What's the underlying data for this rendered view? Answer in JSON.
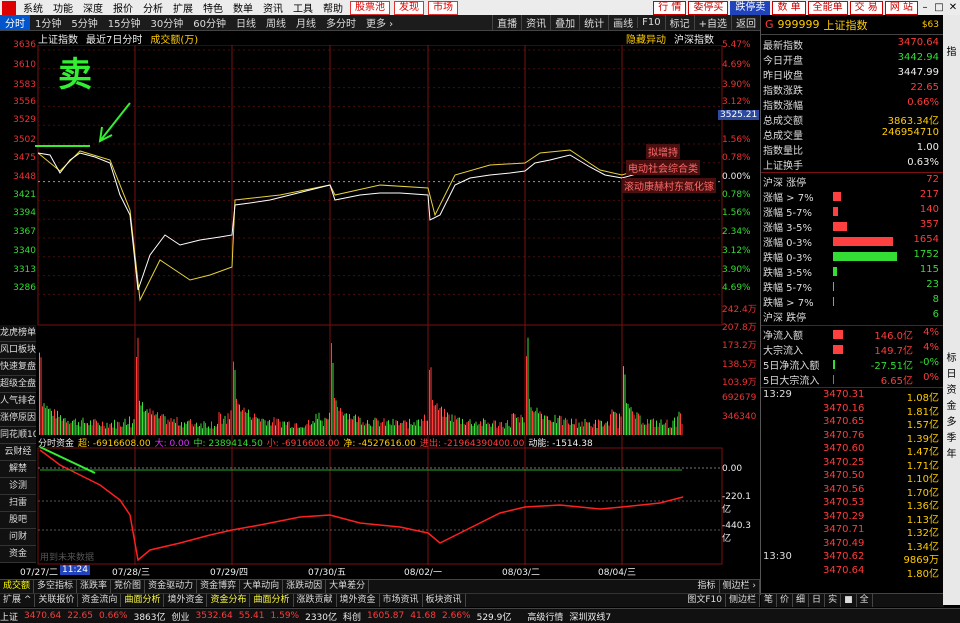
{
  "menubar": {
    "items": [
      "系统",
      "功能",
      "深度",
      "报价",
      "分析",
      "扩展",
      "特色",
      "数单",
      "资讯",
      "工具",
      "帮助"
    ],
    "hot": [
      "股票池",
      "发现",
      "市场"
    ],
    "right_btns": [
      "行 情",
      "委停买",
      "跌停卖",
      "数 单",
      "全能单",
      "交 易",
      "网 站"
    ]
  },
  "toolbar": {
    "periods": [
      "分时",
      "1分钟",
      "5分钟",
      "15分钟",
      "30分钟",
      "60分钟",
      "日线",
      "周线",
      "月线",
      "多分时",
      "更多 ›"
    ],
    "right": [
      "直播",
      "资讯",
      "叠加",
      "统计",
      "画线",
      "F10",
      "标记",
      "+自选",
      "返回"
    ]
  },
  "chart": {
    "index_name": "上证指数",
    "period_label": "最近7日分时",
    "volume_label": "成交额(万)",
    "hidden_move": "隐藏异动",
    "hs_depth": "沪深指数",
    "annotation_sell": "卖",
    "tag1": "拟增持",
    "tag2": "电动社会综合类",
    "tag3": "滚动康赫村东氮化镓",
    "price_marker": "3525.21",
    "y_left": [
      "3636",
      "3610",
      "3583",
      "3556",
      "3529",
      "3502",
      "3475",
      "3448",
      "3421",
      "3394",
      "3367",
      "3340",
      "3313",
      "3286"
    ],
    "y_right": [
      "5.47%",
      "4.69%",
      "3.90%",
      "3.12%",
      "2.34%",
      "1.56%",
      "0.78%",
      "0.00%",
      "0.78%",
      "1.56%",
      "2.34%",
      "3.12%",
      "3.90%",
      "4.69%"
    ],
    "vol_right": [
      "242.4万",
      "207.8万",
      "173.2万",
      "138.5万",
      "103.9万",
      "692679",
      "346340"
    ],
    "x_labels": [
      "07/27/二",
      "11:24",
      "07/28/三",
      "07/29/四",
      "07/30/五",
      "08/02/一",
      "08/03/二",
      "08/04/三"
    ]
  },
  "side_buttons": [
    "龙虎榜单",
    "风口板块",
    "快速复盘",
    "超级全盘",
    "人气排名",
    "涨停原因",
    "同花顺10"
  ],
  "flow_side": [
    "云财经",
    "解禁",
    "诊测",
    "扫雷",
    "股吧",
    "问财",
    "资金"
  ],
  "flow": {
    "title": "分时资金",
    "super": "超: -6916608.00",
    "big": "大: 0.00",
    "mid": "中: 2389414.50",
    "small": "小: -6916608.00",
    "net": "净: -4527616.00",
    "out": "进出: -21964390400.00",
    "power": "动能: -1514.38",
    "y_labels": [
      "0.00",
      "-220.1亿",
      "-440.3亿"
    ],
    "watermark": "用到未来数据"
  },
  "right_panel": {
    "code": "999999",
    "name": "上证指数",
    "badge": "$63",
    "rows": [
      {
        "k": "最新指数",
        "v": "3470.64",
        "c": "red"
      },
      {
        "k": "今日开盘",
        "v": "3442.94",
        "c": "green"
      },
      {
        "k": "昨日收盘",
        "v": "3447.99",
        "c": "wht"
      },
      {
        "k": "指数涨跌",
        "v": "22.65",
        "c": "red"
      },
      {
        "k": "指数涨幅",
        "v": "0.66%",
        "c": "red"
      },
      {
        "k": "总成交额",
        "v": "3863.34亿",
        "c": "yel"
      },
      {
        "k": "总成交量",
        "v": "246954710",
        "c": "yel"
      },
      {
        "k": "指数量比",
        "v": "1.00",
        "c": "wht"
      },
      {
        "k": "上证换手",
        "v": "0.63%",
        "c": "wht"
      }
    ],
    "dist": [
      {
        "k": "沪深 涨停",
        "v": "72",
        "w": 0,
        "c": "red"
      },
      {
        "k": "涨幅 > 7%",
        "v": "217",
        "w": 8,
        "c": "red"
      },
      {
        "k": "涨幅 5-7%",
        "v": "140",
        "w": 5,
        "c": "red"
      },
      {
        "k": "涨幅 3-5%",
        "v": "357",
        "w": 14,
        "c": "red"
      },
      {
        "k": "涨幅 0-3%",
        "v": "1654",
        "w": 60,
        "c": "red"
      },
      {
        "k": "跌幅 0-3%",
        "v": "1752",
        "w": 64,
        "c": "green"
      },
      {
        "k": "跌幅 3-5%",
        "v": "115",
        "w": 4,
        "c": "green"
      },
      {
        "k": "跌幅 5-7%",
        "v": "23",
        "w": 1,
        "c": "green"
      },
      {
        "k": "跌幅 > 7%",
        "v": "8",
        "w": 1,
        "c": "green"
      },
      {
        "k": "沪深 跌停",
        "v": "6",
        "w": 0,
        "c": "green"
      }
    ],
    "flows": [
      {
        "k": "净流入额",
        "v": "146.0亿",
        "p": "4%",
        "w": 10,
        "c": "red"
      },
      {
        "k": "大宗流入",
        "v": "149.7亿",
        "p": "4%",
        "w": 10,
        "c": "red"
      },
      {
        "k": "5日净流入额",
        "v": "-27.51亿",
        "p": "-0%",
        "w": 2,
        "c": "green"
      },
      {
        "k": "5日大宗流入",
        "v": "6.65亿",
        "p": "0%",
        "w": 1,
        "c": "red"
      }
    ],
    "ticks_time1": "13:29",
    "ticks_time2": "13:30",
    "ticks": [
      {
        "p": "3470.31",
        "v": "1.08亿"
      },
      {
        "p": "3470.16",
        "v": "1.81亿"
      },
      {
        "p": "3470.65",
        "v": "1.57亿"
      },
      {
        "p": "3470.76",
        "v": "1.39亿"
      },
      {
        "p": "3470.60",
        "v": "1.47亿"
      },
      {
        "p": "3470.25",
        "v": "1.71亿"
      },
      {
        "p": "3470.50",
        "v": "1.10亿"
      },
      {
        "p": "3470.56",
        "v": "1.70亿"
      },
      {
        "p": "3470.53",
        "v": "1.36亿"
      },
      {
        "p": "3470.29",
        "v": "1.13亿"
      },
      {
        "p": "3470.71",
        "v": "1.32亿"
      },
      {
        "p": "3470.49",
        "v": "1.34亿"
      },
      {
        "p": "3470.62",
        "v": "9869万"
      },
      {
        "p": "3470.64",
        "v": "1.80亿"
      }
    ],
    "bottom_tabs": [
      "笔",
      "价",
      "细",
      "日",
      "实",
      "■",
      "全"
    ]
  },
  "vtabs": [
    "指",
    "标",
    "日",
    "资",
    "金",
    "多",
    "季",
    "年"
  ],
  "tabs_row1": [
    "成交额",
    "多空指标",
    "涨跌率",
    "竞价图",
    "资金驱动力",
    "资金博弈",
    "大单动向",
    "涨跌动因",
    "大单差分"
  ],
  "tabs_row1_right": [
    "指标",
    "侧边栏 ›"
  ],
  "tabs_row2": [
    "扩展 ^",
    "关联报价",
    "资金流向",
    "曲面分析",
    "境外资金",
    "资金分布",
    "曲面分析",
    "涨跌贡献",
    "境外资金",
    "市场资讯",
    "板块资讯"
  ],
  "tabs_row2_right": [
    "图文F10",
    "侧边栏"
  ],
  "status": {
    "sh_label": "上证",
    "sh_val": "3470.64",
    "sh_chg": "22.65",
    "sh_pct": "0.66%",
    "sh_amt": "3863亿",
    "sz_label": "创业",
    "sz_val": "3532.64",
    "sz_chg": "55.41",
    "sz_pct": "1.59%",
    "sz_amt": "2330亿",
    "kc_label": "科创",
    "kc_val": "1605.87",
    "kc_chg": "41.68",
    "kc_pct": "2.66%",
    "kc_amt": "529.9亿",
    "pro": "高级行情",
    "region": "深圳双线7"
  }
}
